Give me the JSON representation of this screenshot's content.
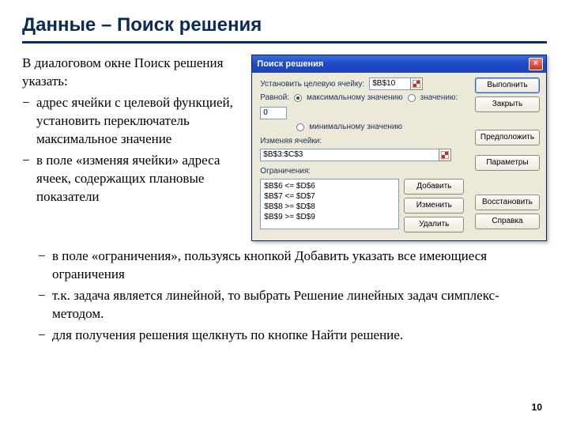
{
  "title": "Данные – Поиск решения",
  "intro": "В диалоговом окне Поиск решения указать:",
  "left_bullets": [
    "адрес ячейки с целевой функцией, установить переключатель максимальное значение",
    "в поле «изменяя ячейки» адреса ячеек, содержащих плановые показатели"
  ],
  "lower_bullets": [
    "в поле «ограничения», пользуясь кнопкой Добавить указать все имеющиеся ограничения",
    "т.к. задача является линейной, то выбрать Решение линейных задач симплекс-методом.",
    "для получения решения щелкнуть по кнопке Найти решение."
  ],
  "page_number": "10",
  "dialog": {
    "title": "Поиск решения",
    "target_label": "Установить целевую ячейку:",
    "target_value": "$B$10",
    "equal_label": "Равной:",
    "radio_max": "максимальному значению",
    "radio_val": "значению:",
    "radio_min": "минимальному значению",
    "value_input": "0",
    "changing_label": "Изменяя ячейки:",
    "changing_value": "$B$3:$C$3",
    "constraints_label": "Ограничения:",
    "constraints": [
      "$B$6 <= $D$6",
      "$B$7 <= $D$7",
      "$B$8 >= $D$8",
      "$B$9 >= $D$9"
    ],
    "btn_solve": "Выполнить",
    "btn_close": "Закрыть",
    "btn_guess": "Предположить",
    "btn_options": "Параметры",
    "btn_add": "Добавить",
    "btn_change": "Изменить",
    "btn_delete": "Удалить",
    "btn_reset": "Восстановить",
    "btn_help": "Справка"
  }
}
